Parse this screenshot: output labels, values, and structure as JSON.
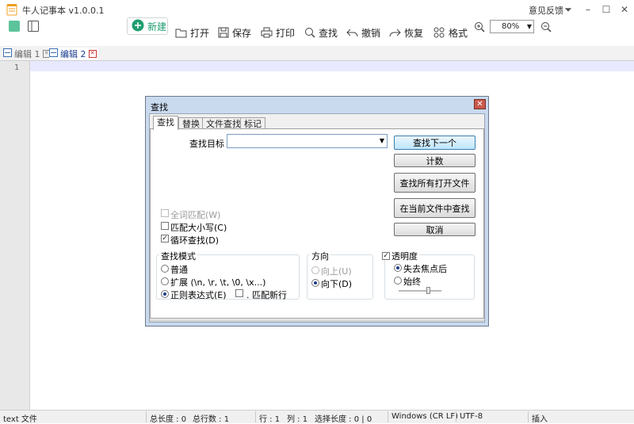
{
  "app": {
    "title": "牛人记事本 v1.0.0.1",
    "feedback": "意见反馈"
  },
  "toolbar": {
    "new_label": "新建",
    "open_label": "打开",
    "save_label": "保存",
    "print_label": "打印",
    "find_label": "查找",
    "undo_label": "撤销",
    "redo_label": "恢复",
    "format_label": "格式",
    "zoom_value": "80%"
  },
  "tabs": [
    {
      "label": "编辑 1"
    },
    {
      "label": "编辑 2"
    }
  ],
  "editor": {
    "line_number": "1"
  },
  "status": {
    "filetype": "text 文件",
    "total_length": "总长度 : 0",
    "total_lines": "总行数 : 1",
    "row": "行 : 1",
    "col": "列 : 1",
    "sel_length": "选择长度 : 0 | 0",
    "eol": "Windows (CR LF)",
    "encoding": "UTF-8",
    "mode": "插入"
  },
  "dialog": {
    "title": "查找",
    "tabs": [
      "查找",
      "替换",
      "文件查找",
      "标记"
    ],
    "find_target_label": "查找目标 :",
    "find_value": "",
    "buttons": {
      "find_next": "查找下一个",
      "count": "计数",
      "find_all_open": "查找所有打开文件",
      "find_in_current": "在当前文件中查找",
      "cancel": "取消"
    },
    "options": {
      "whole_word": "全词匹配(W)",
      "match_case": "匹配大小写(C)",
      "wrap_around": "循环查找(D)"
    },
    "search_mode": {
      "title": "查找模式",
      "normal": "普通",
      "extended": "扩展 (\\n, \\r, \\t, \\0, \\x...)",
      "regex": "正则表达式(E)",
      "dot_newline": ". 匹配新行"
    },
    "direction": {
      "title": "方向",
      "up": "向上(U)",
      "down": "向下(D)"
    },
    "transparency": {
      "title": "透明度",
      "on_lose_focus": "失去焦点后",
      "always": "始终",
      "level": 0.7
    }
  },
  "colors": {
    "accent_green": "#1e9e6f",
    "current_line": "#e8e8ff",
    "dialog_frame": "#c9d9ee"
  }
}
